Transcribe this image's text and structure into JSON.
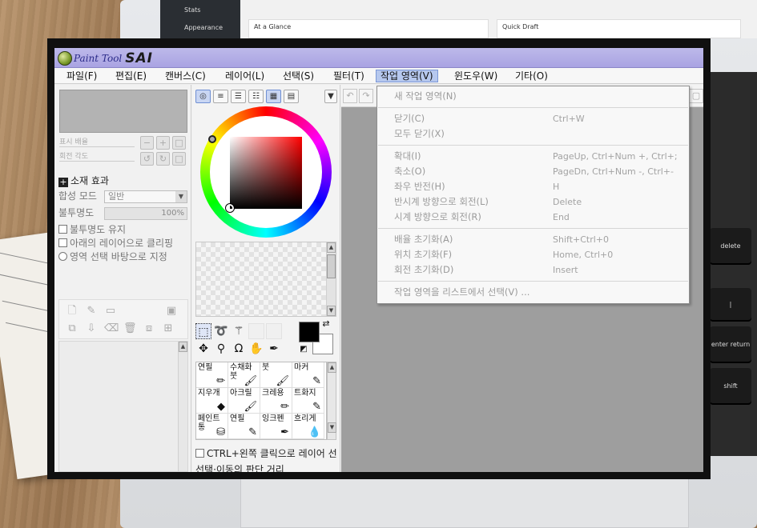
{
  "background": {
    "wp_sidebar": [
      "Stats",
      "Appearance"
    ],
    "wp_cards": [
      "At a Glance",
      "Quick Draft"
    ],
    "keys": [
      "delete",
      "enter return",
      "shift"
    ]
  },
  "app": {
    "title_word": "Paint Tool",
    "title_sai": "SAI",
    "menu": [
      "파일(F)",
      "편집(E)",
      "캔버스(C)",
      "레이어(L)",
      "선택(S)",
      "필터(T)",
      "작업 영역(V)",
      "윈도우(W)",
      "기타(O)"
    ],
    "active_menu_index": 6
  },
  "left_panel": {
    "zoom_label": "표시 배율",
    "angle_label": "회전 각도",
    "effects_label": "소재 효과",
    "blend_label": "합성 모드",
    "blend_value": "일반",
    "opacity_label": "불투명도",
    "opacity_value": "100%",
    "checks": [
      "불투명도 유지",
      "아래의 레이어으로 클리핑",
      "영역 선택 바탕으로 지정"
    ]
  },
  "middle_panel": {
    "brushes": [
      [
        "연필",
        "수채화붓",
        "붓",
        "마커"
      ],
      [
        "지우개",
        "아크릴",
        "크레용",
        "트화지"
      ],
      [
        "페인트통",
        "연필",
        "잉크펜",
        "흐리게"
      ]
    ],
    "ctrl_option": "CTRL+왼쪽 클릭으로 레이어 선",
    "select_distance": "선택·이동의 판단 거리"
  },
  "dropdown": {
    "groups": [
      [
        {
          "label": "새 작업 영역(N)",
          "shortcut": ""
        }
      ],
      [
        {
          "label": "닫기(C)",
          "shortcut": "Ctrl+W"
        },
        {
          "label": "모두 닫기(X)",
          "shortcut": ""
        }
      ],
      [
        {
          "label": "확대(I)",
          "shortcut": "PageUp, Ctrl+Num +, Ctrl+;"
        },
        {
          "label": "축소(O)",
          "shortcut": "PageDn, Ctrl+Num -, Ctrl+-"
        },
        {
          "label": "좌우 반전(H)",
          "shortcut": "H"
        },
        {
          "label": "반시계 방향으로 회전(L)",
          "shortcut": "Delete"
        },
        {
          "label": "시계 방향으로 회전(R)",
          "shortcut": "End"
        }
      ],
      [
        {
          "label": "배율 초기화(A)",
          "shortcut": "Shift+Ctrl+0"
        },
        {
          "label": "위치 초기화(F)",
          "shortcut": "Home, Ctrl+0"
        },
        {
          "label": "회전 초기화(D)",
          "shortcut": "Insert"
        }
      ],
      [
        {
          "label": "작업 영역을 리스트에서 선택(V) ...",
          "shortcut": ""
        }
      ]
    ]
  },
  "colors": {
    "titlebar": "#aaa4e2",
    "menu_highlight": "#b6c8ee",
    "canvas": "#9e9e9e"
  }
}
